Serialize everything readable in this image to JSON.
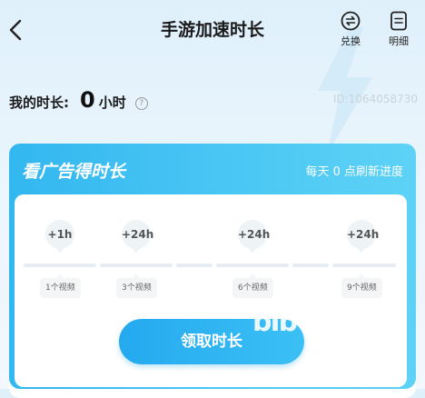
{
  "header": {
    "title": "手游加速时长",
    "exchange_label": "兑换",
    "detail_label": "明细"
  },
  "balance": {
    "label": "我的时长:",
    "value": "0",
    "unit": "小时",
    "user_id": "ID:1064058730"
  },
  "ad_card": {
    "title": "看广告得时长",
    "refresh_note": "每天 0 点刷新进度",
    "steps": [
      {
        "reward": "+1h",
        "videos": "1个视频"
      },
      {
        "reward": "+24h",
        "videos": "3个视频"
      },
      {
        "reward": "+24h",
        "videos": "6个视频"
      },
      {
        "reward": "+24h",
        "videos": "9个视频"
      }
    ],
    "claim_label": "领取时长",
    "decoration_text": "bIb"
  },
  "colors": {
    "accent": "#33b7f0",
    "button": "#25a9ef"
  }
}
